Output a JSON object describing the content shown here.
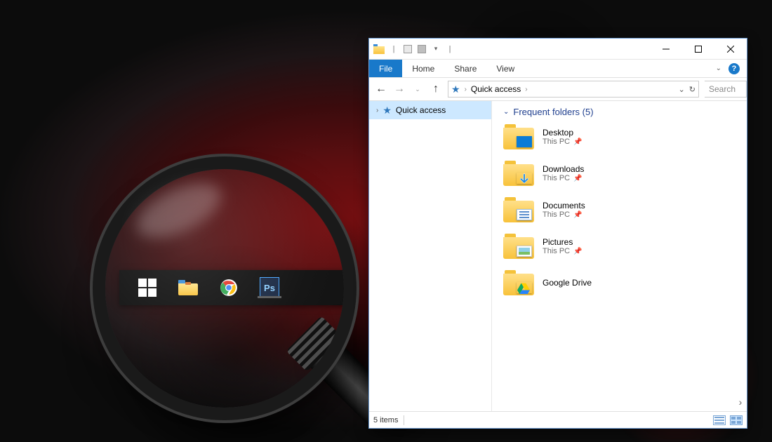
{
  "taskbar": {
    "items": [
      "start",
      "file-explorer",
      "chrome",
      "photoshop"
    ]
  },
  "explorer": {
    "ribbon": {
      "file": "File",
      "home": "Home",
      "share": "Share",
      "view": "View"
    },
    "address": {
      "location": "Quick access",
      "search_placeholder": "Search"
    },
    "sidebar": {
      "quick_access": "Quick access"
    },
    "group": {
      "title": "Frequent folders (5)"
    },
    "folders": [
      {
        "name": "Desktop",
        "location": "This PC",
        "pinned": true,
        "overlay": "desktop"
      },
      {
        "name": "Downloads",
        "location": "This PC",
        "pinned": true,
        "overlay": "downloads"
      },
      {
        "name": "Documents",
        "location": "This PC",
        "pinned": true,
        "overlay": "documents"
      },
      {
        "name": "Pictures",
        "location": "This PC",
        "pinned": true,
        "overlay": "pictures"
      },
      {
        "name": "Google Drive",
        "location": "",
        "pinned": false,
        "overlay": "drive"
      }
    ],
    "status": {
      "count": "5 items"
    }
  }
}
